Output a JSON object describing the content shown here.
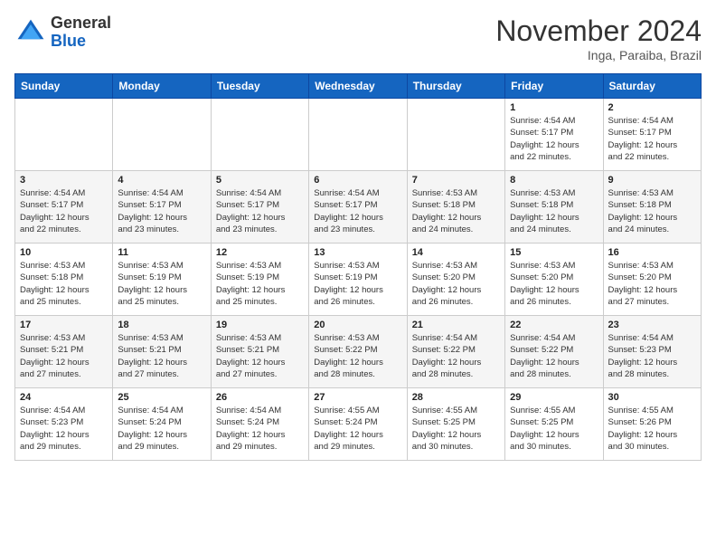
{
  "header": {
    "logo_line1": "General",
    "logo_line2": "Blue",
    "month": "November 2024",
    "location": "Inga, Paraiba, Brazil"
  },
  "weekdays": [
    "Sunday",
    "Monday",
    "Tuesday",
    "Wednesday",
    "Thursday",
    "Friday",
    "Saturday"
  ],
  "weeks": [
    [
      {
        "day": "",
        "info": ""
      },
      {
        "day": "",
        "info": ""
      },
      {
        "day": "",
        "info": ""
      },
      {
        "day": "",
        "info": ""
      },
      {
        "day": "",
        "info": ""
      },
      {
        "day": "1",
        "info": "Sunrise: 4:54 AM\nSunset: 5:17 PM\nDaylight: 12 hours\nand 22 minutes."
      },
      {
        "day": "2",
        "info": "Sunrise: 4:54 AM\nSunset: 5:17 PM\nDaylight: 12 hours\nand 22 minutes."
      }
    ],
    [
      {
        "day": "3",
        "info": "Sunrise: 4:54 AM\nSunset: 5:17 PM\nDaylight: 12 hours\nand 22 minutes."
      },
      {
        "day": "4",
        "info": "Sunrise: 4:54 AM\nSunset: 5:17 PM\nDaylight: 12 hours\nand 23 minutes."
      },
      {
        "day": "5",
        "info": "Sunrise: 4:54 AM\nSunset: 5:17 PM\nDaylight: 12 hours\nand 23 minutes."
      },
      {
        "day": "6",
        "info": "Sunrise: 4:54 AM\nSunset: 5:17 PM\nDaylight: 12 hours\nand 23 minutes."
      },
      {
        "day": "7",
        "info": "Sunrise: 4:53 AM\nSunset: 5:18 PM\nDaylight: 12 hours\nand 24 minutes."
      },
      {
        "day": "8",
        "info": "Sunrise: 4:53 AM\nSunset: 5:18 PM\nDaylight: 12 hours\nand 24 minutes."
      },
      {
        "day": "9",
        "info": "Sunrise: 4:53 AM\nSunset: 5:18 PM\nDaylight: 12 hours\nand 24 minutes."
      }
    ],
    [
      {
        "day": "10",
        "info": "Sunrise: 4:53 AM\nSunset: 5:18 PM\nDaylight: 12 hours\nand 25 minutes."
      },
      {
        "day": "11",
        "info": "Sunrise: 4:53 AM\nSunset: 5:19 PM\nDaylight: 12 hours\nand 25 minutes."
      },
      {
        "day": "12",
        "info": "Sunrise: 4:53 AM\nSunset: 5:19 PM\nDaylight: 12 hours\nand 25 minutes."
      },
      {
        "day": "13",
        "info": "Sunrise: 4:53 AM\nSunset: 5:19 PM\nDaylight: 12 hours\nand 26 minutes."
      },
      {
        "day": "14",
        "info": "Sunrise: 4:53 AM\nSunset: 5:20 PM\nDaylight: 12 hours\nand 26 minutes."
      },
      {
        "day": "15",
        "info": "Sunrise: 4:53 AM\nSunset: 5:20 PM\nDaylight: 12 hours\nand 26 minutes."
      },
      {
        "day": "16",
        "info": "Sunrise: 4:53 AM\nSunset: 5:20 PM\nDaylight: 12 hours\nand 27 minutes."
      }
    ],
    [
      {
        "day": "17",
        "info": "Sunrise: 4:53 AM\nSunset: 5:21 PM\nDaylight: 12 hours\nand 27 minutes."
      },
      {
        "day": "18",
        "info": "Sunrise: 4:53 AM\nSunset: 5:21 PM\nDaylight: 12 hours\nand 27 minutes."
      },
      {
        "day": "19",
        "info": "Sunrise: 4:53 AM\nSunset: 5:21 PM\nDaylight: 12 hours\nand 27 minutes."
      },
      {
        "day": "20",
        "info": "Sunrise: 4:53 AM\nSunset: 5:22 PM\nDaylight: 12 hours\nand 28 minutes."
      },
      {
        "day": "21",
        "info": "Sunrise: 4:54 AM\nSunset: 5:22 PM\nDaylight: 12 hours\nand 28 minutes."
      },
      {
        "day": "22",
        "info": "Sunrise: 4:54 AM\nSunset: 5:22 PM\nDaylight: 12 hours\nand 28 minutes."
      },
      {
        "day": "23",
        "info": "Sunrise: 4:54 AM\nSunset: 5:23 PM\nDaylight: 12 hours\nand 28 minutes."
      }
    ],
    [
      {
        "day": "24",
        "info": "Sunrise: 4:54 AM\nSunset: 5:23 PM\nDaylight: 12 hours\nand 29 minutes."
      },
      {
        "day": "25",
        "info": "Sunrise: 4:54 AM\nSunset: 5:24 PM\nDaylight: 12 hours\nand 29 minutes."
      },
      {
        "day": "26",
        "info": "Sunrise: 4:54 AM\nSunset: 5:24 PM\nDaylight: 12 hours\nand 29 minutes."
      },
      {
        "day": "27",
        "info": "Sunrise: 4:55 AM\nSunset: 5:24 PM\nDaylight: 12 hours\nand 29 minutes."
      },
      {
        "day": "28",
        "info": "Sunrise: 4:55 AM\nSunset: 5:25 PM\nDaylight: 12 hours\nand 30 minutes."
      },
      {
        "day": "29",
        "info": "Sunrise: 4:55 AM\nSunset: 5:25 PM\nDaylight: 12 hours\nand 30 minutes."
      },
      {
        "day": "30",
        "info": "Sunrise: 4:55 AM\nSunset: 5:26 PM\nDaylight: 12 hours\nand 30 minutes."
      }
    ]
  ]
}
